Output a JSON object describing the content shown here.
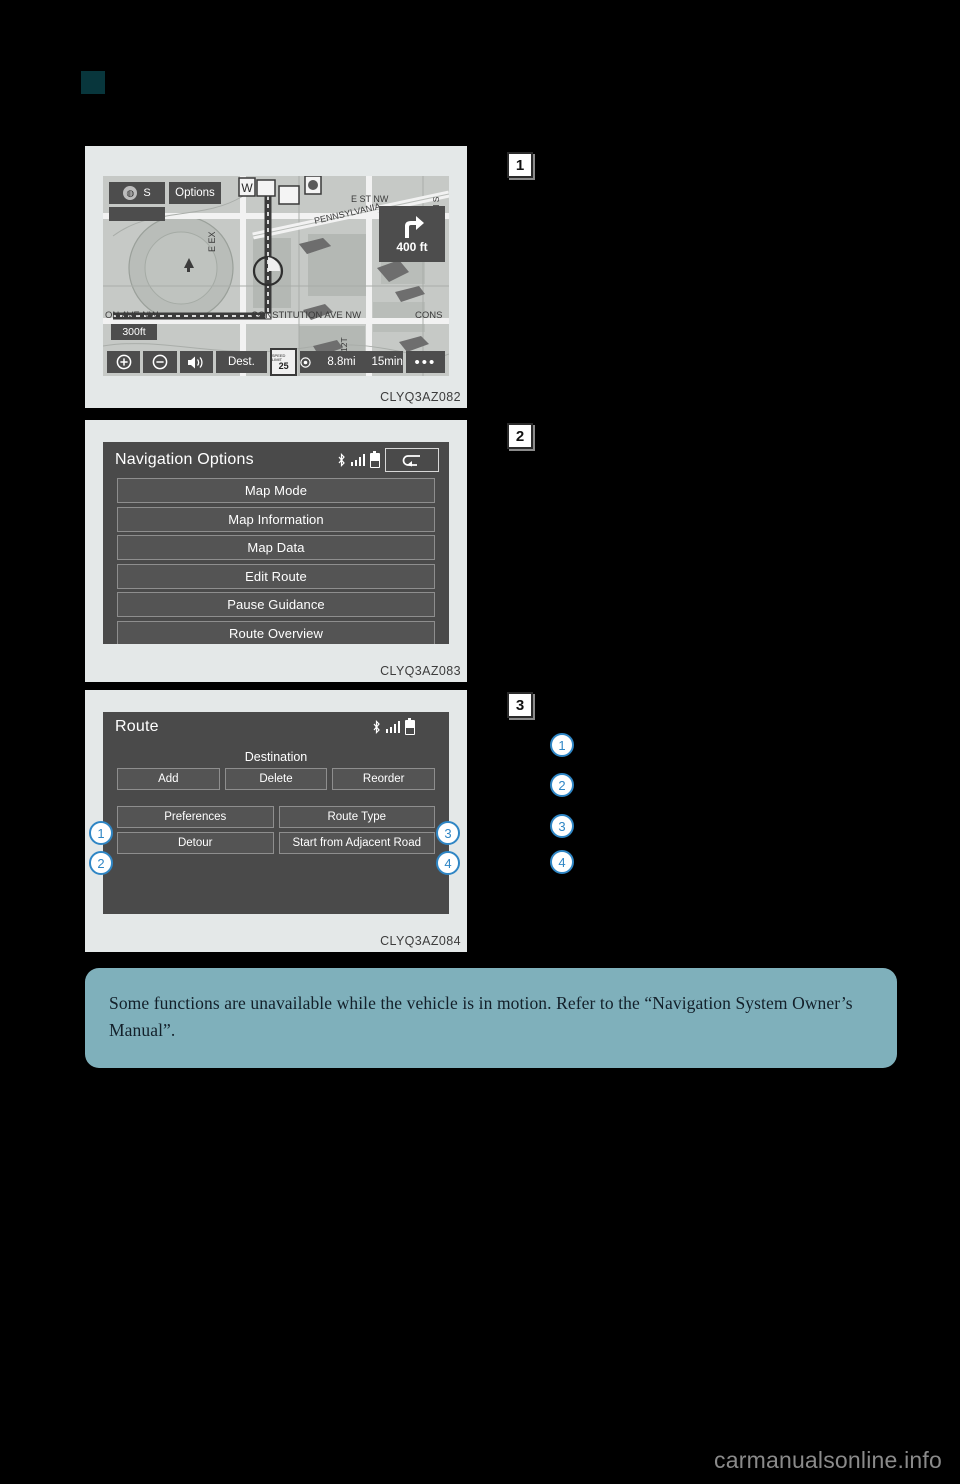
{
  "page": {
    "background_color": "#000000",
    "section_marker_color": "#08363c",
    "footer_text": "carmanualsonline.info"
  },
  "steps": [
    {
      "number": "1"
    },
    {
      "number": "2"
    },
    {
      "number": "3"
    }
  ],
  "figures": [
    {
      "id": "map-screen",
      "caption": "CLYQ3AZ082",
      "screen": {
        "compass_direction": "S",
        "options_label": "Options",
        "turn_arrow_icon": "turn-right-icon",
        "turn_distance": "400 ft",
        "map_scale": "300ft",
        "street_labels": [
          "E ST NW",
          "PENNSYLVANIA",
          "CONSTITUTION AVE NW",
          "ON AVE NW",
          "CONS",
          "E EX",
          "12T",
          "TH S"
        ],
        "bottom_bar": {
          "zoom_in_icon": "plus-circle-icon",
          "zoom_out_icon": "minus-circle-icon",
          "volume_icon": "speaker-icon",
          "destination_label": "Dest.",
          "speed_limit_value": "25",
          "speed_limit_unit": "SPEED LIMIT",
          "remaining_distance": "8.8mi",
          "remaining_time": "15min",
          "more_label": "•••"
        }
      }
    },
    {
      "id": "navigation-options-screen",
      "caption": "CLYQ3AZ083",
      "screen": {
        "title": "Navigation Options",
        "status_icons": [
          "bluetooth-icon",
          "signal-icon",
          "battery-icon"
        ],
        "back_icon": "back-arrow-icon",
        "menu_items": [
          "Map Mode",
          "Map Information",
          "Map Data",
          "Edit Route",
          "Pause Guidance",
          "Route Overview"
        ]
      }
    },
    {
      "id": "route-screen",
      "caption": "CLYQ3AZ084",
      "screen": {
        "title": "Route",
        "status_icons": [
          "bluetooth-icon",
          "signal-icon",
          "battery-icon"
        ],
        "destination_label": "Destination",
        "destination_buttons": [
          "Add",
          "Delete",
          "Reorder"
        ],
        "option_rows": [
          [
            "Preferences",
            "Route Type"
          ],
          [
            "Detour",
            "Start from Adjacent Road"
          ]
        ]
      }
    }
  ],
  "callouts": {
    "accent_color": "#2f86c5",
    "on_screen": [
      {
        "number": "1",
        "target": "Preferences"
      },
      {
        "number": "2",
        "target": "Detour"
      },
      {
        "number": "3",
        "target": "Route Type"
      },
      {
        "number": "4",
        "target": "Start from Adjacent Road"
      }
    ],
    "list": [
      {
        "number": "1"
      },
      {
        "number": "2"
      },
      {
        "number": "3"
      },
      {
        "number": "4"
      }
    ]
  },
  "notice": {
    "background_color": "#7fb0bb",
    "text": "Some functions are unavailable while the vehicle is in motion. Refer to the “Navigation System Owner’s Manual”."
  }
}
